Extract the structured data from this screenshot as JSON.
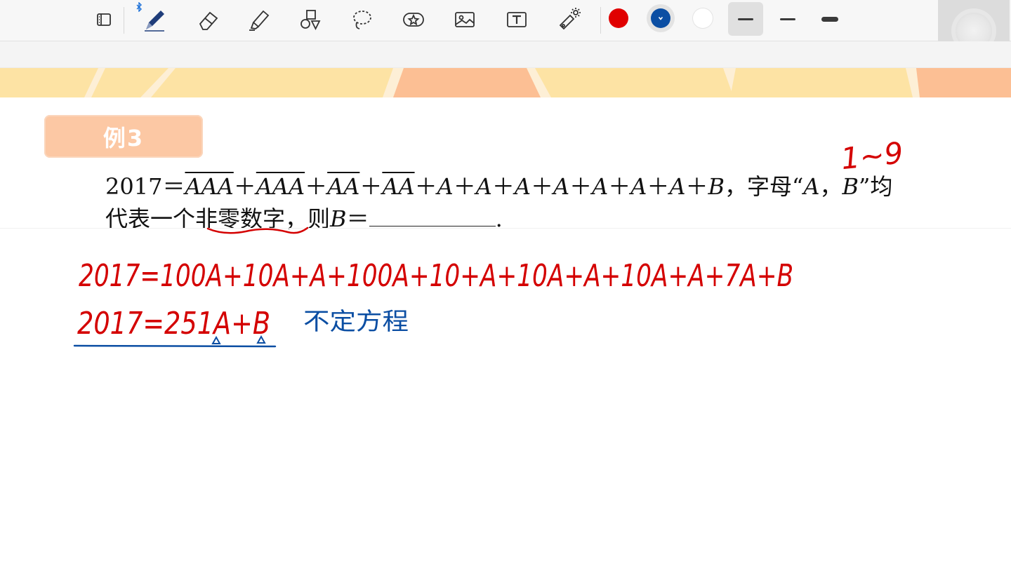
{
  "toolbar": {
    "tools": [
      {
        "name": "pages-icon"
      },
      {
        "name": "pen-icon"
      },
      {
        "name": "eraser-icon"
      },
      {
        "name": "highlighter-icon"
      },
      {
        "name": "shapes-icon"
      },
      {
        "name": "lasso-icon"
      },
      {
        "name": "sticker-icon"
      },
      {
        "name": "image-icon"
      },
      {
        "name": "text-box-icon"
      },
      {
        "name": "laser-pointer-icon"
      }
    ],
    "colors": {
      "red": "#e00000",
      "blue_selected": "#0b4ea3",
      "white": "#ffffff"
    },
    "selected_color": "blue_selected",
    "stroke_widths": [
      "thin",
      "medium",
      "thick"
    ],
    "selected_stroke": "thin"
  },
  "banner_colors": {
    "yellow": "#fde3a4",
    "orange": "#fcbf94",
    "bg": "#fdefd6"
  },
  "content": {
    "example_label": "例3",
    "problem": {
      "prefix": "2017＝",
      "t1": "AAA",
      "t2": "AAA",
      "t3": "AA",
      "t4": "AA",
      "plus": "＋",
      "a": "A",
      "b": "B",
      "line1_suffix_pre": "，字母“",
      "line1_comma": "，",
      "line1_suffix_post": "”均",
      "line2_pre": "代表一个",
      "line2_emph": "非零数字",
      "line2_mid": "，则",
      "line2_eq": "＝",
      "line2_end": "."
    }
  },
  "annotations": {
    "range_note": "1~9",
    "red_line1": "2017=100A+10A+A+100A+10+A+10A+A+10A+A+7A+B",
    "red_line2": "2017=251A+B",
    "blue_note": "不定方程",
    "ink_red": "#d40000",
    "ink_blue": "#0b4ea3"
  }
}
